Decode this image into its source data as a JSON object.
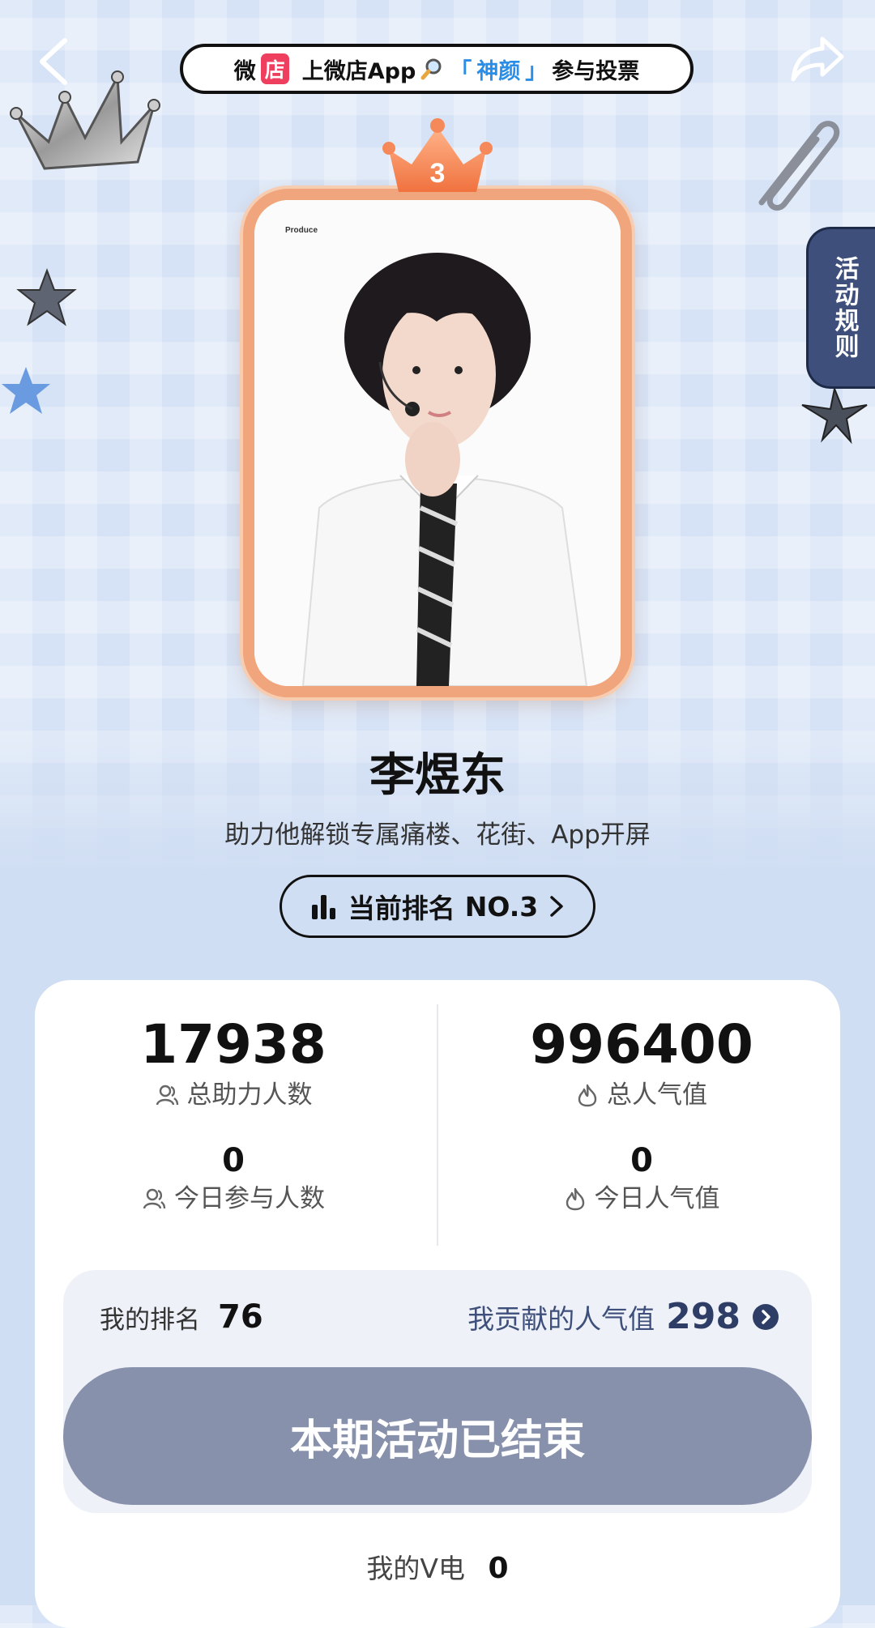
{
  "banner": {
    "store_char1": "微",
    "store_char2": "店",
    "text_before": "上微店App",
    "quote_open": "「",
    "highlight": "神颜",
    "quote_close": "」",
    "text_after": "参与投票"
  },
  "side_tab": {
    "label": "活动规则"
  },
  "rank_badge": {
    "number": "3"
  },
  "candidate": {
    "name": "李煜东",
    "subtitle": "助力他解锁专属痛楼、花街、App开屏",
    "photo_caption": "Produce"
  },
  "rank_pill": {
    "label": "当前排名",
    "value": "NO.3"
  },
  "stats": {
    "total_supporters": {
      "value": "17938",
      "label": "总助力人数"
    },
    "total_popularity": {
      "value": "996400",
      "label": "总人气值"
    },
    "today_participants": {
      "value": "0",
      "label": "今日参与人数"
    },
    "today_popularity": {
      "value": "0",
      "label": "今日人气值"
    }
  },
  "mine": {
    "rank_label": "我的排名",
    "rank_value": "76",
    "contrib_label": "我贡献的人气值",
    "contrib_value": "298"
  },
  "end_button": {
    "label": "本期活动已结束"
  },
  "vdian": {
    "label": "我的V电",
    "value": "0"
  },
  "colors": {
    "accent_navy": "#3d4f7a",
    "frame_orange": "#f0a57c",
    "banner_red": "#ef3f5f",
    "highlight_blue": "#2a8ee6",
    "ended_button": "#8891ab"
  },
  "icons": [
    "back-icon",
    "share-icon",
    "search-icon",
    "crown-icon",
    "bar-chart-icon",
    "chevron-right-icon",
    "user-icon",
    "flame-icon"
  ]
}
